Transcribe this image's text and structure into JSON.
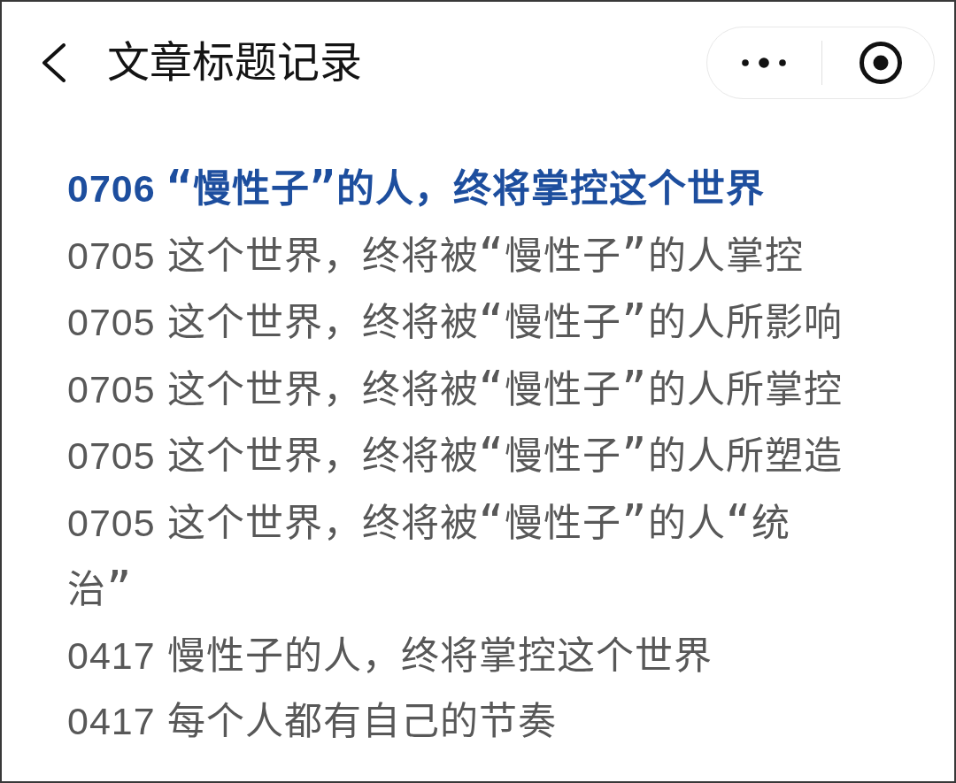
{
  "nav_bar": {
    "title": "文章标题记录"
  },
  "titles": [
    {
      "text": "0706 “慢性子”的人，终将掌控这个世界",
      "selected": true
    },
    {
      "text": "0705 这个世界，终将被“慢性子”的人掌控",
      "selected": false
    },
    {
      "text": "0705 这个世界，终将被“慢性子”的人所影响",
      "selected": false
    },
    {
      "text": "0705 这个世界，终将被“慢性子”的人所掌控",
      "selected": false
    },
    {
      "text": "0705 这个世界，终将被“慢性子”的人所塑造",
      "selected": false
    },
    {
      "text": "0705 这个世界，终将被“慢性子”的人“统治”",
      "selected": false
    },
    {
      "text": "0417 慢性子的人，终将掌控这个世界",
      "selected": false
    },
    {
      "text": "0417 每个人都有自己的节奏",
      "selected": false
    }
  ]
}
